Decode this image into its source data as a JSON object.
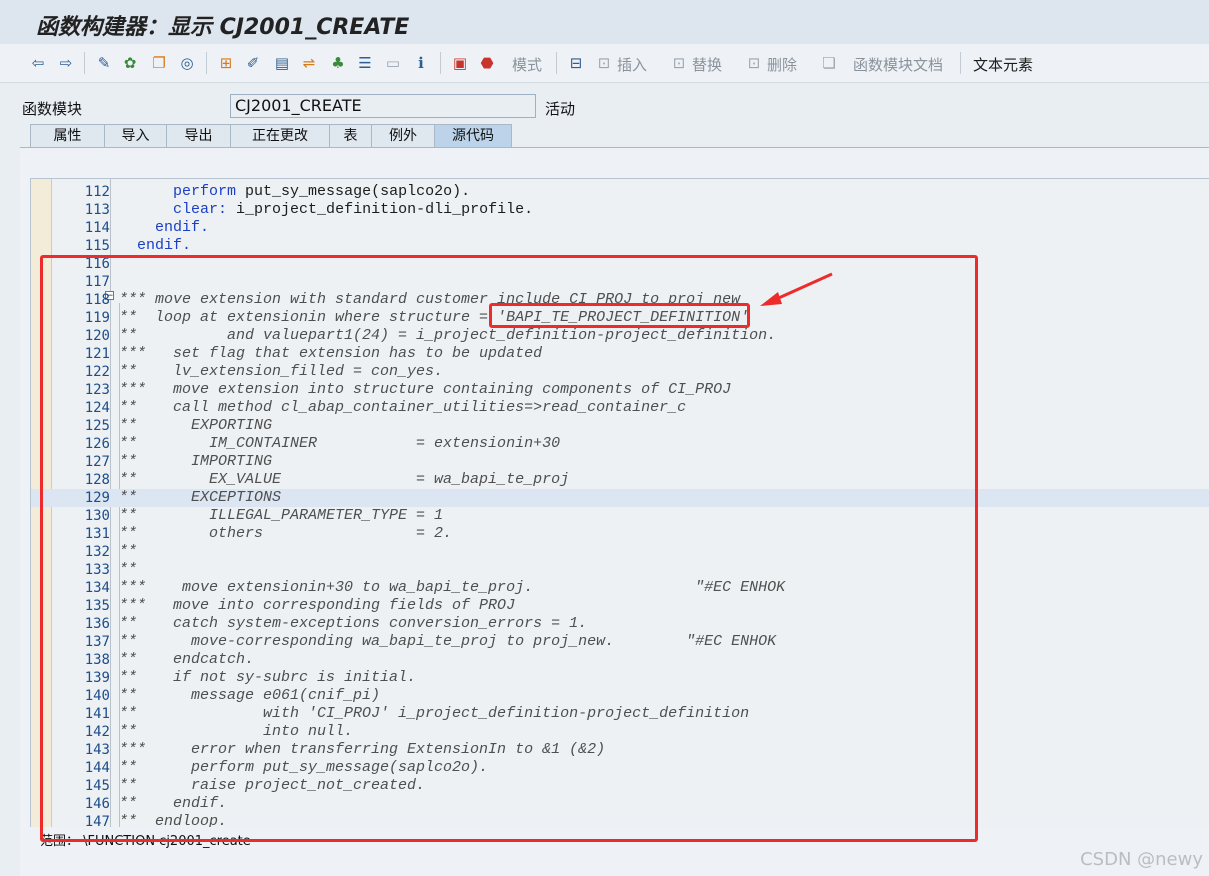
{
  "window": {
    "title": "函数构建器：显示 CJ2001_CREATE"
  },
  "toolbar": {
    "labels": {
      "mode": "模式",
      "insert": "插入",
      "replace": "替换",
      "delete": "删除",
      "fm_doc": "函数模块文档",
      "text_elements": "文本元素"
    },
    "icons": [
      "back-icon",
      "forward-icon",
      "toggle-display-change-icon",
      "activate-icon",
      "copy-icon",
      "check-icon",
      "where-used-icon",
      "test-icon",
      "pattern-icon",
      "pretty-printer-icon",
      "hierarchy-icon",
      "stack-icon",
      "display-object-list-icon",
      "info-icon",
      "breakpoint-icon",
      "stop-icon",
      "mode-icon",
      "insert-icon",
      "replace-icon",
      "delete-icon",
      "doc-icon"
    ]
  },
  "function_module": {
    "label": "函数模块",
    "value": "CJ2001_CREATE",
    "status": "活动"
  },
  "tabs": [
    "属性",
    "导入",
    "导出",
    "正在更改",
    "表",
    "例外",
    "源代码"
  ],
  "active_tab": "源代码",
  "editor": {
    "lines": [
      {
        "no": "112",
        "text": "      perform put_sy_message(saplco2o).",
        "comment": false
      },
      {
        "no": "113",
        "text": "      clear: i_project_definition-dli_profile.",
        "comment": false
      },
      {
        "no": "114",
        "text": "    endif.",
        "comment": false
      },
      {
        "no": "115",
        "text": "  endif.",
        "comment": false
      },
      {
        "no": "116",
        "text": "",
        "comment": false
      },
      {
        "no": "117",
        "text": "",
        "comment": false
      },
      {
        "no": "118",
        "text": "*** move extension with standard customer include CI_PROJ to proj_new",
        "comment": true
      },
      {
        "no": "119",
        "text": "**  loop at extensionin where structure = 'BAPI_TE_PROJECT_DEFINITION'",
        "comment": true
      },
      {
        "no": "120",
        "text": "**          and valuepart1(24) = i_project_definition-project_definition.",
        "comment": true
      },
      {
        "no": "121",
        "text": "***   set flag that extension has to be updated",
        "comment": true
      },
      {
        "no": "122",
        "text": "**    lv_extension_filled = con_yes.",
        "comment": true
      },
      {
        "no": "123",
        "text": "***   move extension into structure containing components of CI_PROJ",
        "comment": true
      },
      {
        "no": "124",
        "text": "**    call method cl_abap_container_utilities=>read_container_c",
        "comment": true
      },
      {
        "no": "125",
        "text": "**      EXPORTING",
        "comment": true
      },
      {
        "no": "126",
        "text": "**        IM_CONTAINER           = extensionin+30",
        "comment": true
      },
      {
        "no": "127",
        "text": "**      IMPORTING",
        "comment": true
      },
      {
        "no": "128",
        "text": "**        EX_VALUE               = wa_bapi_te_proj",
        "comment": true
      },
      {
        "no": "129",
        "text": "**      EXCEPTIONS",
        "comment": true
      },
      {
        "no": "130",
        "text": "**        ILLEGAL_PARAMETER_TYPE = 1",
        "comment": true
      },
      {
        "no": "131",
        "text": "**        others                 = 2.",
        "comment": true
      },
      {
        "no": "132",
        "text": "**",
        "comment": true
      },
      {
        "no": "133",
        "text": "**",
        "comment": true
      },
      {
        "no": "134",
        "text": "***    move extensionin+30 to wa_bapi_te_proj.                  \"#EC ENHOK",
        "comment": true
      },
      {
        "no": "135",
        "text": "***   move into corresponding fields of PROJ",
        "comment": true
      },
      {
        "no": "136",
        "text": "**    catch system-exceptions conversion_errors = 1.",
        "comment": true
      },
      {
        "no": "137",
        "text": "**      move-corresponding wa_bapi_te_proj to proj_new.        \"#EC ENHOK",
        "comment": true
      },
      {
        "no": "138",
        "text": "**    endcatch.",
        "comment": true
      },
      {
        "no": "139",
        "text": "**    if not sy-subrc is initial.",
        "comment": true
      },
      {
        "no": "140",
        "text": "**      message e061(cnif_pi)",
        "comment": true
      },
      {
        "no": "141",
        "text": "**              with 'CI_PROJ' i_project_definition-project_definition",
        "comment": true
      },
      {
        "no": "142",
        "text": "**              into null.",
        "comment": true
      },
      {
        "no": "143",
        "text": "***     error when transferring ExtensionIn to &1 (&2)",
        "comment": true
      },
      {
        "no": "144",
        "text": "**      perform put_sy_message(saplco2o).",
        "comment": true
      },
      {
        "no": "145",
        "text": "**      raise project_not_created.",
        "comment": true
      },
      {
        "no": "146",
        "text": "**    endif.",
        "comment": true
      },
      {
        "no": "147",
        "text": "**  endloop.",
        "comment": true
      }
    ],
    "current_line": "129"
  },
  "scope": "范围：  \\FUNCTION cj2001_create",
  "watermark": "CSDN @newy",
  "colors": {
    "highlight": "#ee2b2b",
    "keyword": "#1a3fc4",
    "comment": "#4f4f4f",
    "line_number": "#1d4d8a"
  }
}
